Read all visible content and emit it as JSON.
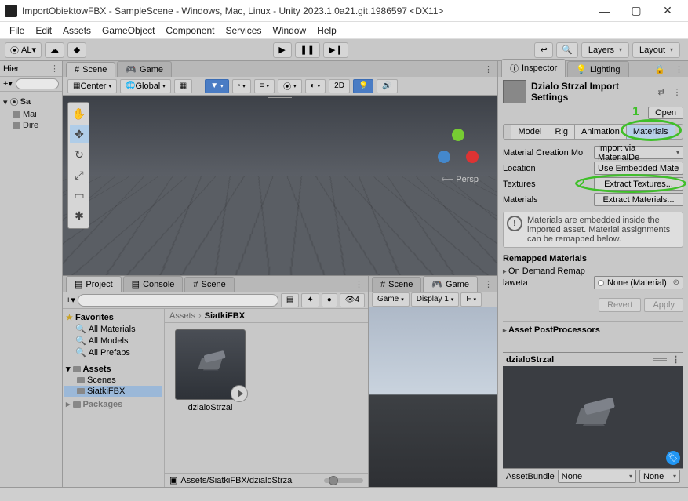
{
  "window": {
    "title": "ImportObiektowFBX - SampleScene - Windows, Mac, Linux - Unity 2023.1.0a21.git.1986597 <DX11>"
  },
  "menu": [
    "File",
    "Edit",
    "Assets",
    "GameObject",
    "Component",
    "Services",
    "Window",
    "Help"
  ],
  "main_toolbar": {
    "account": "AL",
    "layers": "Layers",
    "layout": "Layout"
  },
  "hierarchy": {
    "tab": "Hier",
    "root": "Sa",
    "items": [
      "Mai",
      "Dire"
    ]
  },
  "scene_tabs": {
    "scene": "Scene",
    "game": "Game"
  },
  "scene_toolbar": {
    "pivot": "Center",
    "space": "Global",
    "twod": "2D",
    "persp_label": "Persp"
  },
  "tool_palette": [
    "✋",
    "✥",
    "↻",
    "⤢",
    "▭",
    "✱"
  ],
  "project": {
    "tabs": [
      "Project",
      "Console",
      "Scene"
    ],
    "favorites": "Favorites",
    "fav_items": [
      "All Materials",
      "All Models",
      "All Prefabs"
    ],
    "assets": "Assets",
    "asset_folders": [
      "Scenes",
      "SiatkiFBX"
    ],
    "packages": "Packages",
    "breadcrumb_root": "Assets",
    "breadcrumb_leaf": "SiatkiFBX",
    "thumb_label": "dzialoStrzal",
    "path": "Assets/SiatkiFBX/dzialoStrzal"
  },
  "game_pane": {
    "tabs": [
      "Scene",
      "Game"
    ],
    "aspect": "Game",
    "display": "Display 1",
    "free": "F"
  },
  "inspector": {
    "tabs": {
      "inspector": "Inspector",
      "lighting": "Lighting"
    },
    "asset_title": "Dzialo Strzal Import Settings",
    "open": "Open",
    "import_tabs": [
      "Model",
      "Rig",
      "Animation",
      "Materials"
    ],
    "props": {
      "mat_mode_label": "Material Creation Mo",
      "mat_mode_value": "Import via MaterialDe",
      "location_label": "Location",
      "location_value": "Use Embedded Mate",
      "textures_label": "Textures",
      "textures_btn": "Extract Textures...",
      "materials_label": "Materials",
      "materials_btn": "Extract Materials..."
    },
    "anno1": "1",
    "anno2": "2",
    "info": "Materials are embedded inside the imported asset. Material assignments can be remapped below.",
    "remapped": "Remapped Materials",
    "on_demand": "On Demand Remap",
    "remap_name": "laweta",
    "remap_value": "None (Material)",
    "revert": "Revert",
    "apply": "Apply",
    "postproc": "Asset PostProcessors",
    "preview_name": "dzialoStrzal",
    "bundle_label": "AssetBundle",
    "bundle_value": "None",
    "bundle_variant": "None"
  }
}
